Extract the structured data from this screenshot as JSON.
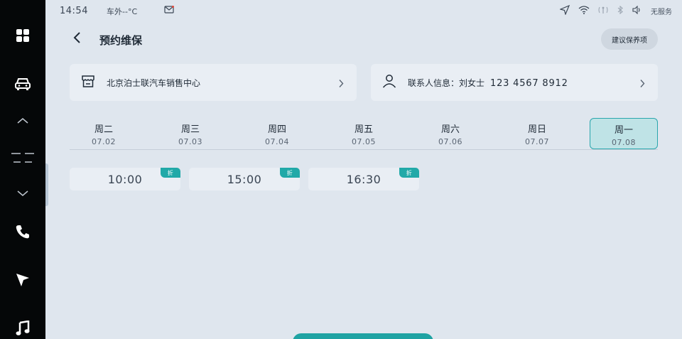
{
  "status": {
    "time": "14:54",
    "temp": "车外--°C",
    "no_service": "无服务"
  },
  "header": {
    "title": "预约维保",
    "suggest_label": "建议保养项"
  },
  "dealer": {
    "name": "北京泊士联汽车销售中心"
  },
  "contact": {
    "label": "联系人信息：刘女士",
    "phone": "123 4567 8912"
  },
  "dates": [
    {
      "weekday": "周二",
      "date": "07.02"
    },
    {
      "weekday": "周三",
      "date": "07.03"
    },
    {
      "weekday": "周四",
      "date": "07.04"
    },
    {
      "weekday": "周五",
      "date": "07.05"
    },
    {
      "weekday": "周六",
      "date": "07.06"
    },
    {
      "weekday": "周日",
      "date": "07.07"
    },
    {
      "weekday": "周一",
      "date": "07.08"
    }
  ],
  "selected_date_index": 6,
  "slots": [
    {
      "time": "10:00",
      "tag": "折"
    },
    {
      "time": "15:00",
      "tag": "折"
    },
    {
      "time": "16:30",
      "tag": "折"
    }
  ],
  "colors": {
    "accent": "#21a9a8",
    "background": "#dfe6ee",
    "dock": "#050708"
  },
  "icons": {
    "dock": [
      "apps-grid-icon",
      "car-icon",
      "chevron-up-icon",
      "split-lines-icon",
      "chevron-down-icon",
      "phone-icon",
      "navigation-arrow-icon",
      "music-note-icon"
    ],
    "status": [
      "mail-icon",
      "location-arrow-icon",
      "wifi-icon",
      "signal-icon",
      "bluetooth-icon",
      "volume-icon"
    ]
  }
}
